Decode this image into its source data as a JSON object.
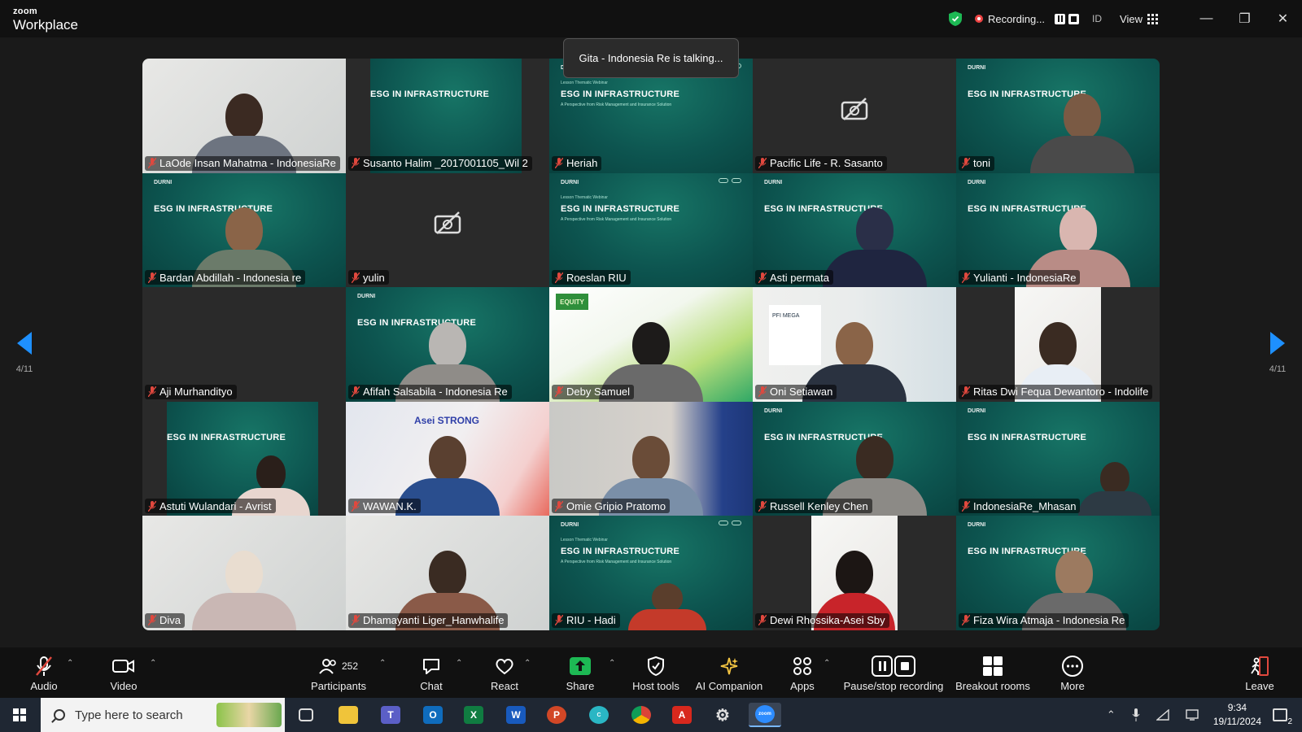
{
  "titlebar": {
    "brand_top": "zoom",
    "brand_bottom": "Workplace",
    "recording_label": "Recording...",
    "id_label": "ID",
    "view_label": "View"
  },
  "talking_indicator": "Gita - Indonesia Re is talking...",
  "pagination": {
    "left_label": "4/11",
    "right_label": "4/11"
  },
  "slide": {
    "head": "DURNI",
    "sub": "Lesson Thematic Webinar",
    "title": "ESG IN INFRASTRUCTURE",
    "tagline": "A Perspective from Risk Management and Insurance Solution"
  },
  "participants": [
    {
      "name": "LaOde Insan Mahatma - IndonesiaRe"
    },
    {
      "name": "Susanto Halim _2017001105_Wil 2"
    },
    {
      "name": "Heriah"
    },
    {
      "name": "Pacific Life - R. Sasanto"
    },
    {
      "name": "toni"
    },
    {
      "name": "Bardan Abdillah - Indonesia re"
    },
    {
      "name": "yulin"
    },
    {
      "name": "Roeslan RIU"
    },
    {
      "name": "Asti permata"
    },
    {
      "name": "Yulianti - IndonesiaRe"
    },
    {
      "name": "Aji Murhandityo"
    },
    {
      "name": "Afifah Salsabila - Indonesia Re"
    },
    {
      "name": "Deby Samuel"
    },
    {
      "name": "Oni Setiawan"
    },
    {
      "name": "Ritas Dwi Fequa Dewantoro - Indolife"
    },
    {
      "name": "Astuti Wulandari - Avrist"
    },
    {
      "name": "WAWAN.K."
    },
    {
      "name": "Omie Gripio Pratomo"
    },
    {
      "name": "Russell Kenley Chen"
    },
    {
      "name": "IndonesiaRe_Mhasan"
    },
    {
      "name": "Diva"
    },
    {
      "name": "Dhamayanti Liger_Hanwhalife"
    },
    {
      "name": "RIU - Hadi"
    },
    {
      "name": "Dewi Rhossika-Asei Sby"
    },
    {
      "name": "Fiza Wira Atmaja - Indonesia Re"
    }
  ],
  "tile_text": {
    "equity_logo": "EQUITY",
    "asei_logo": "Asei STRONG",
    "pfi_logo": "PFI MEGA"
  },
  "toolbar": {
    "audio": "Audio",
    "video": "Video",
    "participants": "Participants",
    "participants_count": "252",
    "chat": "Chat",
    "react": "React",
    "share": "Share",
    "host_tools": "Host tools",
    "ai_companion": "AI Companion",
    "apps": "Apps",
    "pause_stop": "Pause/stop recording",
    "breakout": "Breakout rooms",
    "more": "More",
    "leave": "Leave"
  },
  "taskbar": {
    "search_placeholder": "Type here to search",
    "time": "9:34",
    "date": "19/11/2024",
    "notification_count": "2"
  },
  "colors": {
    "accent": "#1e90ff",
    "share_green": "#1db954",
    "mic_off_red": "#e0483e",
    "slide_teal": "#0d5550"
  }
}
